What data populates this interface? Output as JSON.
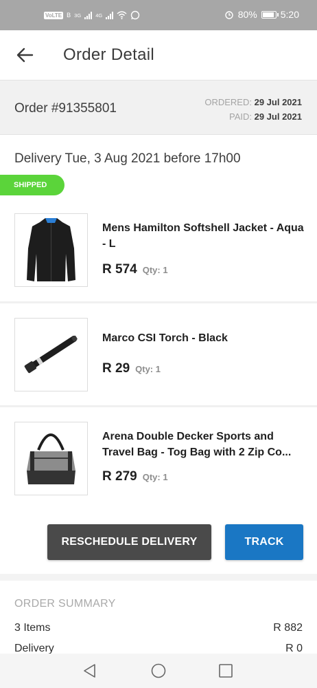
{
  "status_bar": {
    "volte": "VoLTE",
    "b_label": "B",
    "net1": "3G",
    "net2": "4G",
    "battery": "80%",
    "time": "5:20"
  },
  "header": {
    "title": "Order Detail"
  },
  "order": {
    "number": "Order #91355801",
    "ordered_label": "ORDERED:",
    "ordered_date": "29 Jul 2021",
    "paid_label": "PAID:",
    "paid_date": "29 Jul 2021",
    "delivery": "Delivery Tue, 3 Aug 2021 before 17h00",
    "status": "SHIPPED"
  },
  "items": [
    {
      "name": "Mens Hamilton Softshell Jacket - Aqua - L",
      "price": "R 574",
      "qty": "Qty: 1"
    },
    {
      "name": "Marco CSI Torch - Black",
      "price": "R 29",
      "qty": "Qty: 1"
    },
    {
      "name": "Arena Double Decker Sports and Travel Bag - Tog Bag with 2 Zip Co...",
      "price": "R 279",
      "qty": "Qty: 1"
    }
  ],
  "actions": {
    "reschedule": "RESCHEDULE DELIVERY",
    "track": "TRACK"
  },
  "summary": {
    "heading": "ORDER SUMMARY",
    "items_label": "3 Items",
    "items_value": "R 882",
    "delivery_label": "Delivery",
    "delivery_value": "R 0"
  },
  "colors": {
    "shipped": "#5bd43a",
    "track": "#1a77c4",
    "reschedule": "#4a4a4a"
  }
}
